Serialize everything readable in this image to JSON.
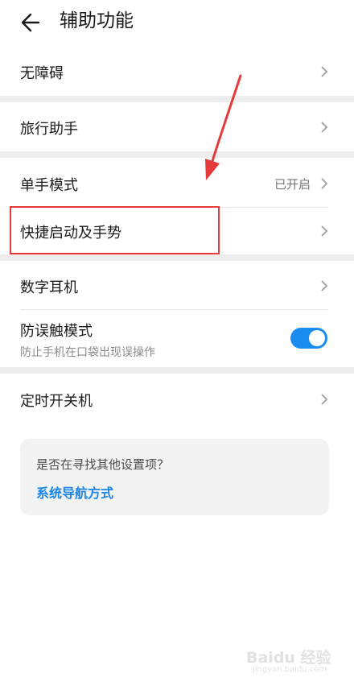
{
  "header": {
    "title": "辅助功能"
  },
  "groups": [
    {
      "items": [
        {
          "label": "无障碍"
        }
      ]
    },
    {
      "items": [
        {
          "label": "旅行助手"
        }
      ]
    },
    {
      "items": [
        {
          "label": "单手模式",
          "value": "已开启"
        },
        {
          "label": "快捷启动及手势"
        }
      ]
    },
    {
      "items": [
        {
          "label": "数字耳机"
        },
        {
          "label": "防误触模式",
          "sublabel": "防止手机在口袋出现误操作",
          "toggle_on": true
        }
      ]
    },
    {
      "items": [
        {
          "label": "定时开关机"
        }
      ]
    }
  ],
  "suggestion": {
    "question": "是否在寻找其他设置项？",
    "link": "系统导航方式"
  },
  "colors": {
    "accent": "#1a86e8",
    "toggle": "#1a8cf0",
    "annotation": "#e63a3a",
    "separator": "#ededed"
  },
  "watermark": {
    "logo": "Baidu 经验",
    "url": "jingyan.baidu.com"
  }
}
